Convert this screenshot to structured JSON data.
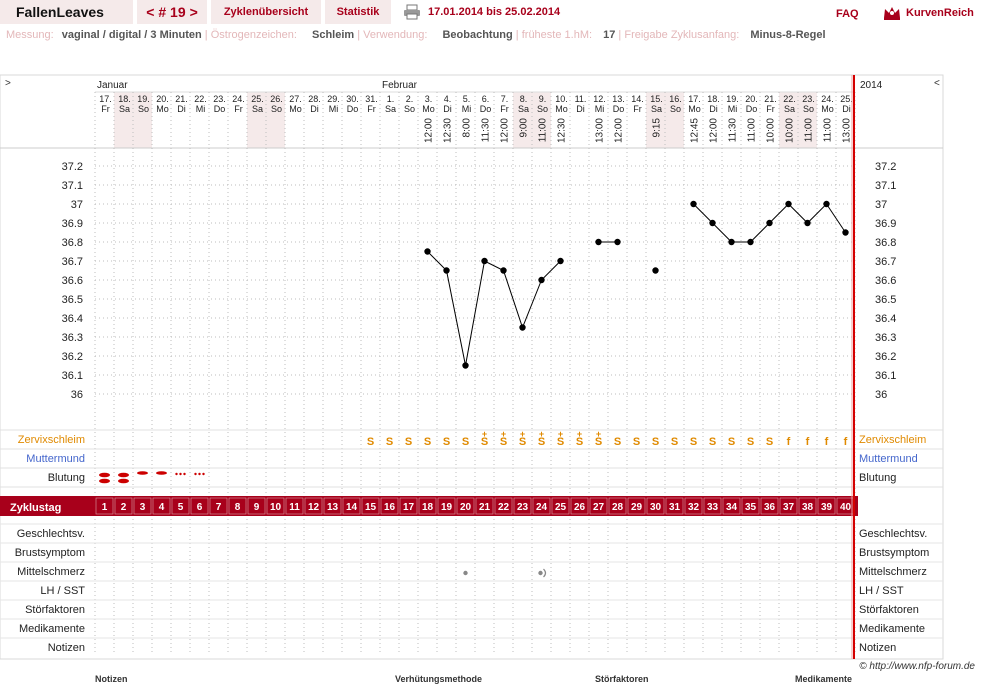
{
  "header": {
    "brand": "FallenLeaves",
    "cycle_label": "# 19",
    "prev": "<",
    "next": ">",
    "tabs": [
      {
        "label": "Zyklenübersicht",
        "x": 222,
        "w": 100
      },
      {
        "label": "Statistik",
        "x": 326,
        "w": 67
      }
    ],
    "date_range": "17.01.2014 bis 25.02.2014",
    "faq": "FAQ",
    "kurvenreich": "KurvenReich",
    "accent": "#a8001b"
  },
  "info": [
    {
      "label": "Messung:",
      "value": "vaginal / digital / 3 Minuten"
    },
    {
      "label": "Östrogenzeichen:",
      "value": "Schleim"
    },
    {
      "label": "Verwendung:",
      "value": "Beobachtung"
    },
    {
      "label": "früheste 1.hM:",
      "value": "17"
    },
    {
      "label": "Freigabe Zyklusanfang:",
      "value": "Minus-8-Regel"
    }
  ],
  "chart_data": {
    "type": "line",
    "year": "2014",
    "months": [
      "Januar",
      "Februar"
    ],
    "days": [
      "17.",
      "18.",
      "19.",
      "20.",
      "21.",
      "22.",
      "23.",
      "24.",
      "25.",
      "26.",
      "27.",
      "28.",
      "29.",
      "30.",
      "31.",
      "1.",
      "2.",
      "3.",
      "4.",
      "5.",
      "6.",
      "7.",
      "8.",
      "9.",
      "10.",
      "11.",
      "12.",
      "13.",
      "14.",
      "15.",
      "16.",
      "17.",
      "18.",
      "19.",
      "20.",
      "21.",
      "22.",
      "23.",
      "24.",
      "25."
    ],
    "weekdays": [
      "Fr",
      "Sa",
      "So",
      "Mo",
      "Di",
      "Mi",
      "Do",
      "Fr",
      "Sa",
      "So",
      "Mo",
      "Di",
      "Mi",
      "Do",
      "Fr",
      "Sa",
      "So",
      "Mo",
      "Di",
      "Mi",
      "Do",
      "Fr",
      "Sa",
      "So",
      "Mo",
      "Di",
      "Mi",
      "Do",
      "Fr",
      "Sa",
      "So",
      "Mo",
      "Di",
      "Mi",
      "Do",
      "Fr",
      "Sa",
      "So",
      "Mo",
      "Di"
    ],
    "times": [
      "",
      "",
      "",
      "",
      "",
      "",
      "",
      "",
      "",
      "",
      "",
      "",
      "",
      "",
      "",
      "",
      "",
      "12:00",
      "12:30",
      "8:00",
      "11:30",
      "12:00",
      "9:00",
      "11:00",
      "12:30",
      "",
      "13:00",
      "12:00",
      "",
      "9:15",
      "",
      "12:45",
      "12:00",
      "11:30",
      "11:00",
      "10:00",
      "10:00",
      "11:00",
      "11:00",
      "13:00"
    ],
    "cycle_days": [
      "1",
      "2",
      "3",
      "4",
      "5",
      "6",
      "7",
      "8",
      "9",
      "10",
      "11",
      "12",
      "13",
      "14",
      "15",
      "16",
      "17",
      "18",
      "19",
      "20",
      "21",
      "22",
      "23",
      "24",
      "25",
      "26",
      "27",
      "28",
      "29",
      "30",
      "31",
      "32",
      "33",
      "34",
      "35",
      "36",
      "37",
      "38",
      "39",
      "40"
    ],
    "ylabels": [
      "37.2",
      "37.1",
      "37",
      "36.9",
      "36.8",
      "36.7",
      "36.6",
      "36.5",
      "36.4",
      "36.3",
      "36.2",
      "36.1",
      "36"
    ],
    "ylim": [
      36.0,
      37.2
    ],
    "temperatures": [
      null,
      null,
      null,
      null,
      null,
      null,
      null,
      null,
      null,
      null,
      null,
      null,
      null,
      null,
      null,
      null,
      null,
      36.75,
      36.65,
      36.15,
      36.7,
      36.65,
      36.35,
      36.6,
      36.7,
      null,
      36.8,
      36.8,
      null,
      36.65,
      null,
      37.0,
      36.9,
      36.8,
      36.8,
      36.9,
      37.0,
      36.9,
      37.0,
      36.85
    ],
    "line_segments": [
      [
        17,
        24
      ],
      [
        26,
        27
      ],
      [
        31,
        39
      ]
    ],
    "cervical_mucus": [
      "",
      "",
      "",
      "",
      "",
      "",
      "",
      "",
      "",
      "",
      "",
      "",
      "",
      "",
      "S",
      "S",
      "S",
      "S",
      "S",
      "S",
      "S+",
      "S+",
      "S+",
      "S+",
      "S+",
      "S+",
      "S+",
      "S",
      "S",
      "S",
      "S",
      "S",
      "S",
      "S",
      "S",
      "S",
      "f",
      "f",
      "f",
      "f"
    ],
    "bleeding": [
      "heavy",
      "heavy",
      "light",
      "light",
      "spotting",
      "spotting",
      "",
      "",
      "",
      "",
      "",
      "",
      "",
      "",
      "",
      "",
      "",
      "",
      "",
      "",
      "",
      "",
      "",
      "",
      "",
      "",
      "",
      "",
      "",
      "",
      "",
      "",
      "",
      "",
      "",
      "",
      "",
      "",
      "",
      ""
    ],
    "row_labels": {
      "mucus": "Zervixschleim",
      "cervix": "Muttermund",
      "bleeding": "Blutung",
      "cycle_day": "Zyklustag",
      "extras": [
        "Geschlechtsv.",
        "Brustsymptom",
        "Mittelschmerz",
        "LH / SST",
        "Störfaktoren",
        "Medikamente",
        "Notizen"
      ]
    },
    "mittelschmerz_marks": [
      19,
      23
    ],
    "weekend_shading": [
      1,
      2,
      8,
      9,
      22,
      23,
      29,
      30,
      36,
      37
    ],
    "colors": {
      "mucus": "#e08a00",
      "cervix": "#4466cc",
      "bleeding": "#cc0000",
      "accent": "#a8001b",
      "grid": "#bdbdbd",
      "weekend": "#f5eaea"
    }
  },
  "footer": {
    "credit": "© http://www.nfp-forum.de",
    "sections": [
      "Notizen",
      "Verhütungsmethode",
      "Störfaktoren",
      "Medikamente"
    ]
  }
}
